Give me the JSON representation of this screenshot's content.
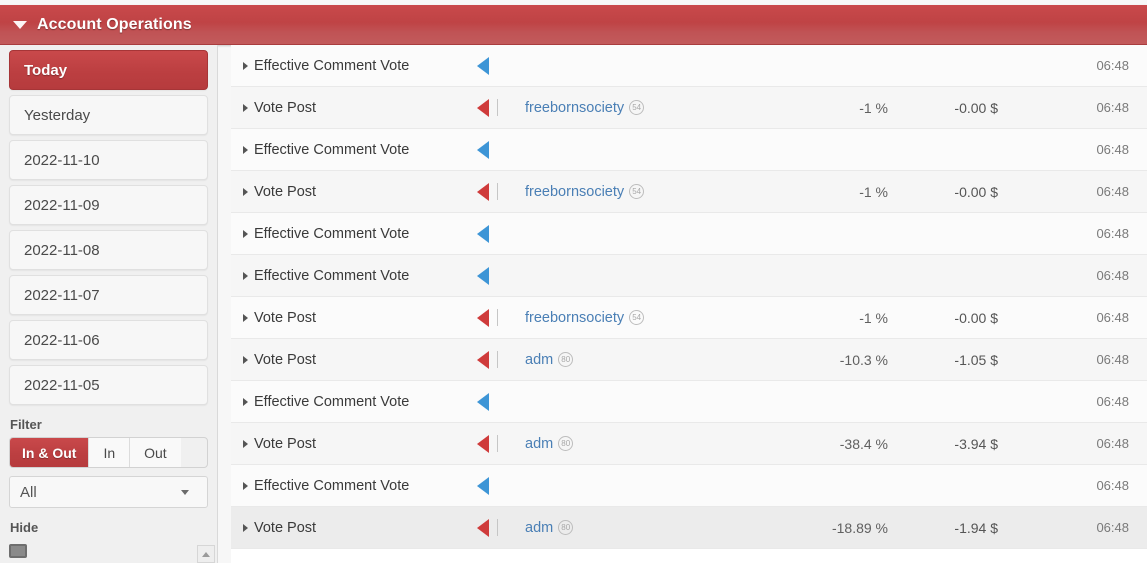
{
  "header": {
    "title": "Account Operations",
    "caret_icon": "caret-down-icon"
  },
  "sidebar": {
    "dates": [
      {
        "label": "Today",
        "active": true
      },
      {
        "label": "Yesterday",
        "active": false
      },
      {
        "label": "2022-11-10",
        "active": false
      },
      {
        "label": "2022-11-09",
        "active": false
      },
      {
        "label": "2022-11-08",
        "active": false
      },
      {
        "label": "2022-11-07",
        "active": false
      },
      {
        "label": "2022-11-06",
        "active": false
      },
      {
        "label": "2022-11-05",
        "active": false
      }
    ],
    "filter_label": "Filter",
    "filter_buttons": [
      {
        "label": "In & Out",
        "active": true
      },
      {
        "label": "In",
        "active": false
      },
      {
        "label": "Out",
        "active": false
      }
    ],
    "select_value": "All",
    "hide_label": "Hide"
  },
  "table": {
    "rows": [
      {
        "type": "Effective Comment Vote",
        "direction": "in",
        "user": "",
        "rep": "",
        "percent": "",
        "amount": "",
        "time": "06:48"
      },
      {
        "type": "Vote Post",
        "direction": "out",
        "user": "freebornsociety",
        "rep": "54",
        "percent": "-1 %",
        "amount": "-0.00 $",
        "time": "06:48"
      },
      {
        "type": "Effective Comment Vote",
        "direction": "in",
        "user": "",
        "rep": "",
        "percent": "",
        "amount": "",
        "time": "06:48"
      },
      {
        "type": "Vote Post",
        "direction": "out",
        "user": "freebornsociety",
        "rep": "54",
        "percent": "-1 %",
        "amount": "-0.00 $",
        "time": "06:48"
      },
      {
        "type": "Effective Comment Vote",
        "direction": "in",
        "user": "",
        "rep": "",
        "percent": "",
        "amount": "",
        "time": "06:48"
      },
      {
        "type": "Effective Comment Vote",
        "direction": "in",
        "user": "",
        "rep": "",
        "percent": "",
        "amount": "",
        "time": "06:48"
      },
      {
        "type": "Vote Post",
        "direction": "out",
        "user": "freebornsociety",
        "rep": "54",
        "percent": "-1 %",
        "amount": "-0.00 $",
        "time": "06:48"
      },
      {
        "type": "Vote Post",
        "direction": "out",
        "user": "adm",
        "rep": "80",
        "percent": "-10.3 %",
        "amount": "-1.05 $",
        "time": "06:48"
      },
      {
        "type": "Effective Comment Vote",
        "direction": "in",
        "user": "",
        "rep": "",
        "percent": "",
        "amount": "",
        "time": "06:48"
      },
      {
        "type": "Vote Post",
        "direction": "out",
        "user": "adm",
        "rep": "80",
        "percent": "-38.4 %",
        "amount": "-3.94 $",
        "time": "06:48"
      },
      {
        "type": "Effective Comment Vote",
        "direction": "in",
        "user": "",
        "rep": "",
        "percent": "",
        "amount": "",
        "time": "06:48"
      },
      {
        "type": "Vote Post",
        "direction": "out",
        "user": "adm",
        "rep": "80",
        "percent": "-18.89 %",
        "amount": "-1.94 $",
        "time": "06:48"
      }
    ]
  },
  "colors": {
    "accent_red": "#bf4345",
    "arrow_in_blue": "#3d95d6",
    "arrow_out_red": "#cf3b3b",
    "username_blue": "#4a7fb5"
  }
}
